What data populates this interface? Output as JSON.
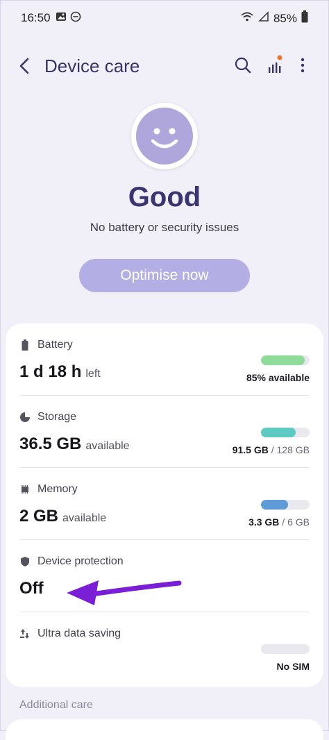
{
  "status_bar": {
    "time": "16:50",
    "battery_pct": "85%"
  },
  "header": {
    "title": "Device care"
  },
  "hero": {
    "status": "Good",
    "subtitle": "No battery or security issues",
    "optimise_label": "Optimise now"
  },
  "items": [
    {
      "label": "Battery",
      "value": "1 d 18 h",
      "suffix": "left",
      "right_bold": "85% available",
      "right_muted": "",
      "fill": 0.9,
      "color": "#8fdc9a"
    },
    {
      "label": "Storage",
      "value": "36.5 GB",
      "suffix": "available",
      "right_bold": "91.5 GB",
      "right_muted": " / 128 GB",
      "fill": 0.72,
      "color": "#5dcac4"
    },
    {
      "label": "Memory",
      "value": "2 GB",
      "suffix": "available",
      "right_bold": "3.3 GB",
      "right_muted": " / 6 GB",
      "fill": 0.55,
      "color": "#5f9bd8"
    },
    {
      "label": "Device protection",
      "value": "Off",
      "suffix": "",
      "right_bold": "",
      "right_muted": "",
      "fill": null,
      "color": ""
    },
    {
      "label": "Ultra data saving",
      "value": "",
      "suffix": "",
      "right_bold": "No SIM",
      "right_muted": "",
      "fill": 0,
      "color": "#d6d5dc"
    }
  ],
  "additional": {
    "label": "Additional care"
  },
  "colors": {
    "accent": "#37336a",
    "button": "#b3aee3",
    "annotation_arrow": "#7b1fd6"
  }
}
